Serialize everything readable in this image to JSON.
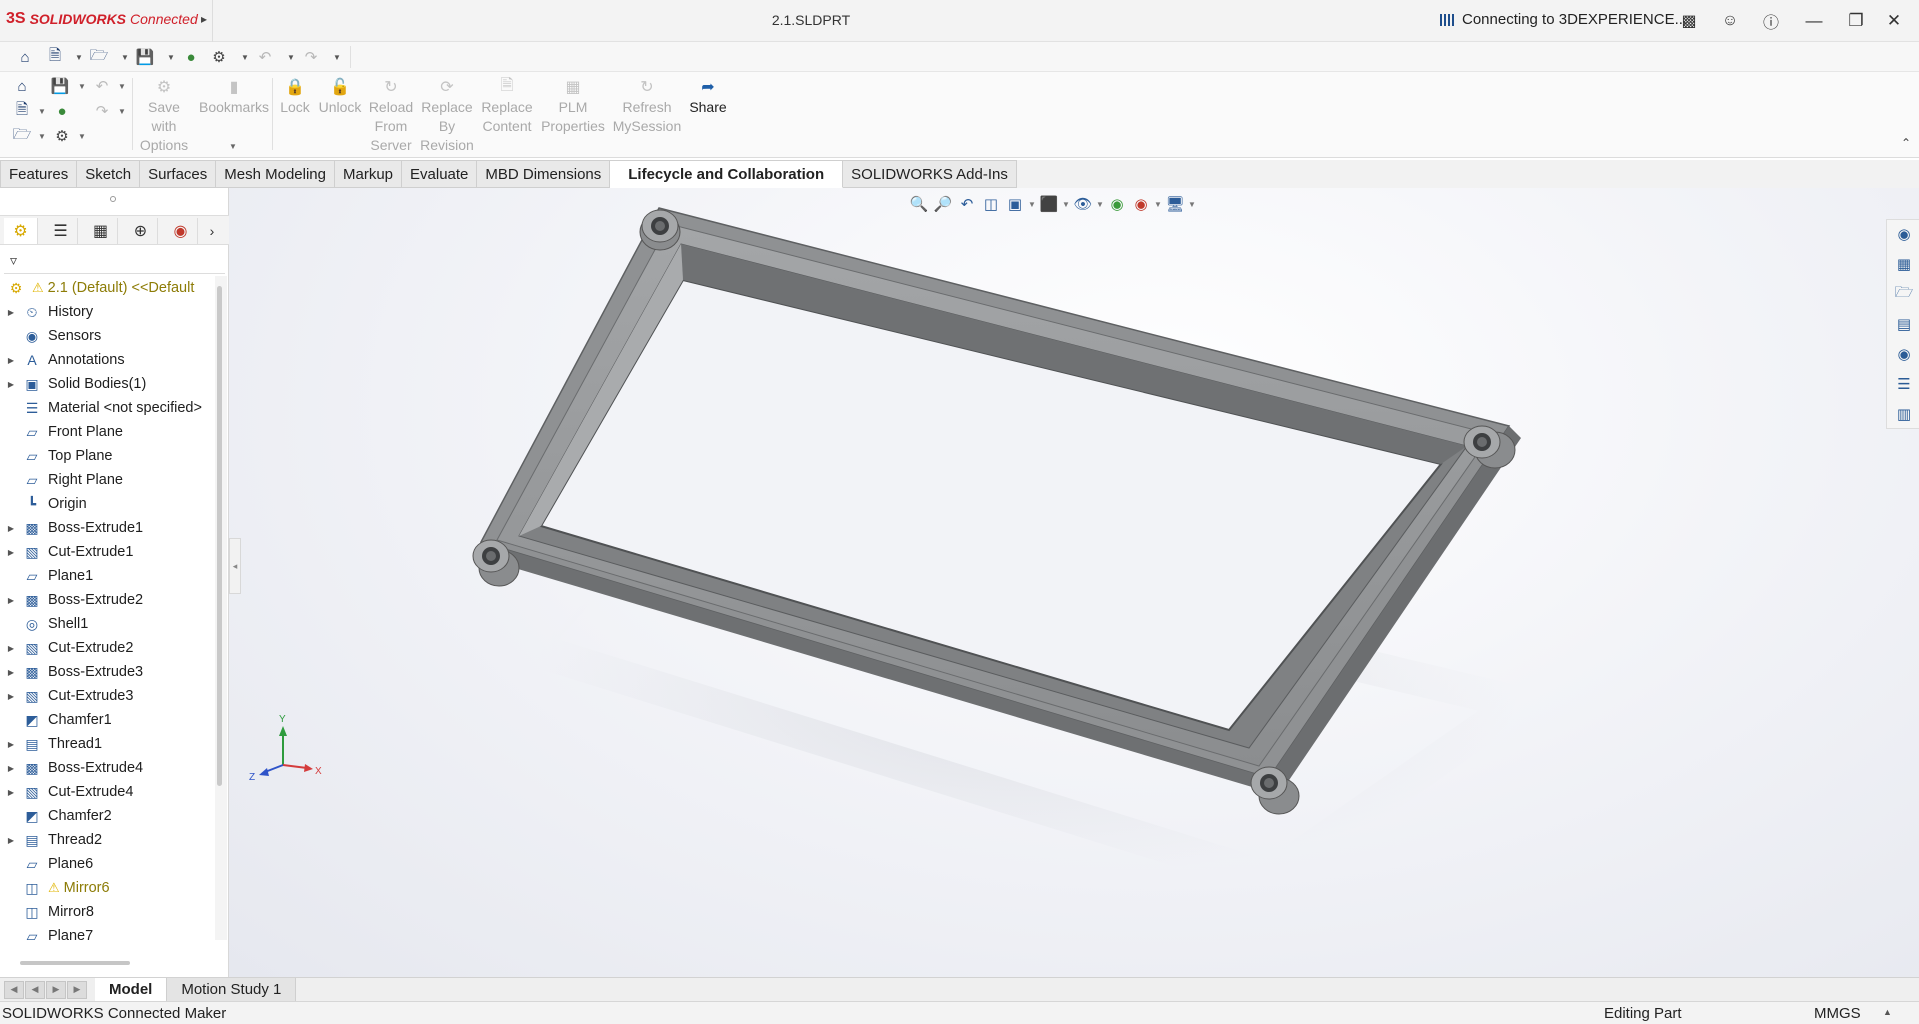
{
  "titlebar": {
    "logo_ds": "3S",
    "logo_sw": "SOLIDWORKS",
    "logo_connected": "Connected",
    "document_title": "2.1.SLDPRT",
    "connection_status": "Connecting to 3DEXPERIENCE...",
    "icons": [
      "home-icon",
      "terminal-icon",
      "user-icon",
      "help-icon",
      "minimize-icon",
      "restore-icon",
      "close-icon"
    ]
  },
  "command_manager": {
    "buttons": [
      {
        "label": "Save\nwith\nOptions",
        "enabled": false
      },
      {
        "label": "Bookmarks",
        "enabled": false
      },
      {
        "label": "Lock",
        "enabled": false
      },
      {
        "label": "Unlock",
        "enabled": false
      },
      {
        "label": "Reload\nFrom\nServer",
        "enabled": false
      },
      {
        "label": "Replace\nBy\nRevision",
        "enabled": false
      },
      {
        "label": "Replace\nContent",
        "enabled": false
      },
      {
        "label": "PLM\nProperties",
        "enabled": false
      },
      {
        "label": "Refresh\nMySession",
        "enabled": false
      },
      {
        "label": "Share",
        "enabled": true
      }
    ]
  },
  "tabs": [
    {
      "label": "Features",
      "active": false
    },
    {
      "label": "Sketch",
      "active": false
    },
    {
      "label": "Surfaces",
      "active": false
    },
    {
      "label": "Mesh Modeling",
      "active": false
    },
    {
      "label": "Markup",
      "active": false
    },
    {
      "label": "Evaluate",
      "active": false
    },
    {
      "label": "MBD Dimensions",
      "active": false
    },
    {
      "label": "Lifecycle and Collaboration",
      "active": true
    },
    {
      "label": "SOLIDWORKS Add-Ins",
      "active": false
    }
  ],
  "feature_tree": {
    "root": "2.1  (Default) <<Default",
    "items": [
      {
        "label": "History",
        "icon": "history-icon",
        "expandable": true,
        "warning": false
      },
      {
        "label": "Sensors",
        "icon": "sensor-icon",
        "expandable": false,
        "warning": false
      },
      {
        "label": "Annotations",
        "icon": "annotation-icon",
        "expandable": true,
        "warning": false
      },
      {
        "label": "Solid Bodies(1)",
        "icon": "solid-bodies-icon",
        "expandable": true,
        "warning": false
      },
      {
        "label": "Material <not specified>",
        "icon": "material-icon",
        "expandable": false,
        "warning": false
      },
      {
        "label": "Front Plane",
        "icon": "plane-icon",
        "expandable": false,
        "warning": false
      },
      {
        "label": "Top Plane",
        "icon": "plane-icon",
        "expandable": false,
        "warning": false
      },
      {
        "label": "Right Plane",
        "icon": "plane-icon",
        "expandable": false,
        "warning": false
      },
      {
        "label": "Origin",
        "icon": "origin-icon",
        "expandable": false,
        "warning": false
      },
      {
        "label": "Boss-Extrude1",
        "icon": "boss-extrude-icon",
        "expandable": true,
        "warning": false
      },
      {
        "label": "Cut-Extrude1",
        "icon": "cut-extrude-icon",
        "expandable": true,
        "warning": false
      },
      {
        "label": "Plane1",
        "icon": "plane-icon",
        "expandable": false,
        "warning": false
      },
      {
        "label": "Boss-Extrude2",
        "icon": "boss-extrude-icon",
        "expandable": true,
        "warning": false
      },
      {
        "label": "Shell1",
        "icon": "shell-icon",
        "expandable": false,
        "warning": false
      },
      {
        "label": "Cut-Extrude2",
        "icon": "cut-extrude-icon",
        "expandable": true,
        "warning": false
      },
      {
        "label": "Boss-Extrude3",
        "icon": "boss-extrude-icon",
        "expandable": true,
        "warning": false
      },
      {
        "label": "Cut-Extrude3",
        "icon": "cut-extrude-icon",
        "expandable": true,
        "warning": false
      },
      {
        "label": "Chamfer1",
        "icon": "chamfer-icon",
        "expandable": false,
        "warning": false
      },
      {
        "label": "Thread1",
        "icon": "thread-icon",
        "expandable": true,
        "warning": false
      },
      {
        "label": "Boss-Extrude4",
        "icon": "boss-extrude-icon",
        "expandable": true,
        "warning": false
      },
      {
        "label": "Cut-Extrude4",
        "icon": "cut-extrude-icon",
        "expandable": true,
        "warning": false
      },
      {
        "label": "Chamfer2",
        "icon": "chamfer-icon",
        "expandable": false,
        "warning": false
      },
      {
        "label": "Thread2",
        "icon": "thread-icon",
        "expandable": true,
        "warning": false
      },
      {
        "label": "Plane6",
        "icon": "plane-icon",
        "expandable": false,
        "warning": false
      },
      {
        "label": "Mirror6",
        "icon": "mirror-icon",
        "expandable": false,
        "warning": true
      },
      {
        "label": "Mirror8",
        "icon": "mirror-icon",
        "expandable": false,
        "warning": false
      },
      {
        "label": "Plane7",
        "icon": "plane-icon",
        "expandable": false,
        "warning": false
      }
    ]
  },
  "triad": {
    "x": "X",
    "y": "Y",
    "z": "Z"
  },
  "bottom_tabs": [
    {
      "label": "Model",
      "active": true
    },
    {
      "label": "Motion Study 1",
      "active": false
    }
  ],
  "status": {
    "left": "SOLIDWORKS Connected Maker",
    "mode": "Editing Part",
    "units": "MMGS"
  },
  "colors": {
    "brand_red": "#d0202a",
    "accent_blue": "#1f5fa8",
    "part_grey": "#8f9193"
  }
}
